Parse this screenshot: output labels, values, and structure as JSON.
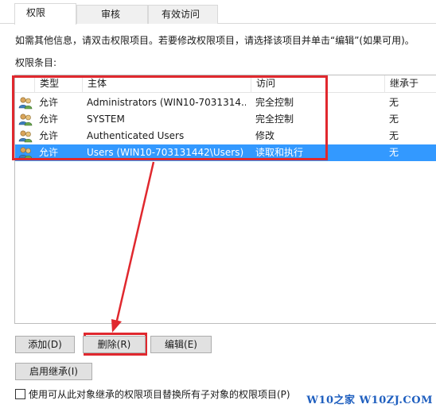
{
  "tabs": [
    {
      "label": "权限",
      "active": true
    },
    {
      "label": "审核",
      "active": false
    },
    {
      "label": "有效访问",
      "active": false
    }
  ],
  "description": "如需其他信息，请双击权限项目。若要修改权限项目，请选择该项目并单击“编辑”(如果可用)。",
  "list_label": "权限条目:",
  "columns": {
    "type": "类型",
    "principal": "主体",
    "access": "访问",
    "inherited": "继承于"
  },
  "rows": [
    {
      "icon": "users-group-icon",
      "type": "允许",
      "principal": "Administrators (WIN10-7031314...",
      "access": "完全控制",
      "inherited": "无",
      "selected": false
    },
    {
      "icon": "users-group-icon",
      "type": "允许",
      "principal": "SYSTEM",
      "access": "完全控制",
      "inherited": "无",
      "selected": false
    },
    {
      "icon": "users-group-icon",
      "type": "允许",
      "principal": "Authenticated Users",
      "access": "修改",
      "inherited": "无",
      "selected": false
    },
    {
      "icon": "users-group-icon",
      "type": "允许",
      "principal": "Users (WIN10-703131442\\Users)",
      "access": "读取和执行",
      "inherited": "无",
      "selected": true
    }
  ],
  "buttons": {
    "add": "添加(D)",
    "remove": "删除(R)",
    "edit": "编辑(E)",
    "enable_inheritance": "启用继承(I)"
  },
  "checkbox": {
    "label": "使用可从此对象继承的权限项目替换所有子对象的权限项目(P)",
    "checked": false
  },
  "watermark": "W10之家 W10ZJ.COM",
  "colors": {
    "selection": "#3399ff",
    "annotation": "#e0282e",
    "watermark": "#1f5fbf"
  }
}
